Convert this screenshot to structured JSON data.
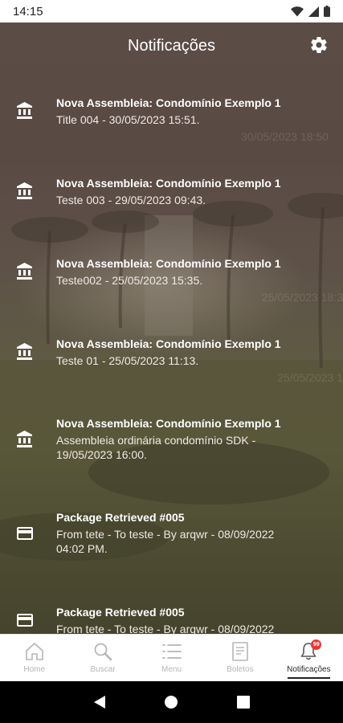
{
  "status_bar": {
    "time": "14:15",
    "icons": [
      "wifi-icon",
      "signal-icon",
      "battery-icon"
    ]
  },
  "header": {
    "title": "Notificações",
    "settings_icon": "gear-icon"
  },
  "notifications": [
    {
      "icon": "bank-icon",
      "title": "Nova Assembleia: Condomínio Exemplo 1",
      "body": "Title 004 - 30/05/2023 15:51.",
      "ghost": "30/05/2023 18:50"
    },
    {
      "icon": "bank-icon",
      "title": "Nova Assembleia: Condomínio Exemplo 1",
      "body": "Teste 003 - 29/05/2023 09:43.",
      "ghost": ""
    },
    {
      "icon": "bank-icon",
      "title": "Nova Assembleia: Condomínio Exemplo 1",
      "body": "Teste002 - 25/05/2023 15:35.",
      "ghost": "25/05/2023 18:3"
    },
    {
      "icon": "bank-icon",
      "title": "Nova Assembleia: Condomínio Exemplo 1",
      "body": "Teste 01 - 25/05/2023 11:13.",
      "ghost": "25/05/2023 1"
    },
    {
      "icon": "bank-icon",
      "title": "Nova Assembleia: Condomínio Exemplo 1",
      "body": "Assembleia ordinária condomínio SDK - 19/05/2023 16:00.",
      "ghost": ""
    },
    {
      "icon": "card-icon",
      "title": "Package Retrieved #005",
      "body": "From tete - To teste - By arqwr - 08/09/2022 04:02 PM.",
      "ghost": ""
    },
    {
      "icon": "card-icon",
      "title": "Package Retrieved #005",
      "body": "From tete - To teste - By arqwr - 08/09/2022",
      "ghost": ""
    }
  ],
  "bottom_nav": [
    {
      "label": "Home",
      "icon": "home-icon",
      "active": false
    },
    {
      "label": "Buscar",
      "icon": "search-icon",
      "active": false
    },
    {
      "label": "Menu",
      "icon": "menu-icon",
      "active": false
    },
    {
      "label": "Boletos",
      "icon": "document-icon",
      "active": false
    },
    {
      "label": "Notificações",
      "icon": "bell-icon",
      "active": true,
      "badge": "99"
    }
  ],
  "colors": {
    "accent": "#e53935",
    "header_text": "#ffffff",
    "nav_inactive": "#b5b5b5",
    "nav_active": "#2a2a2a"
  }
}
